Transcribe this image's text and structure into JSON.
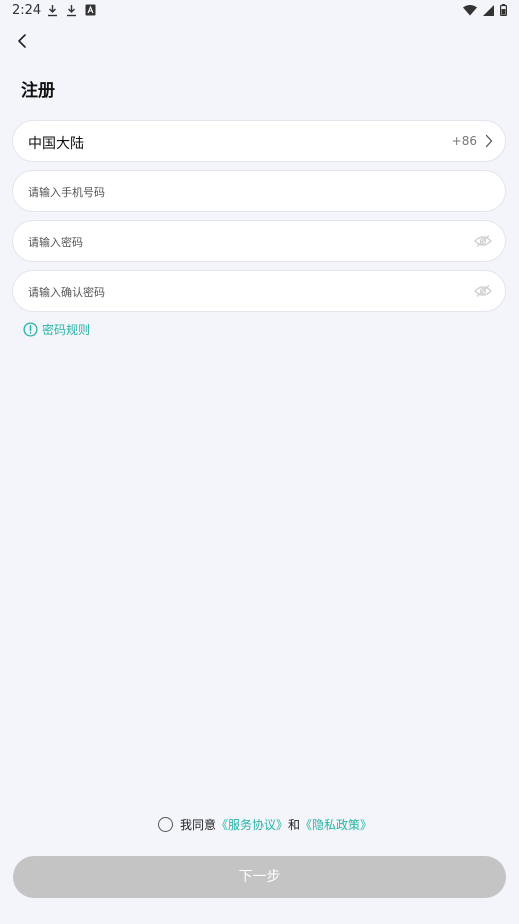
{
  "status_bar": {
    "time": "2:24",
    "icons": [
      "download-icon",
      "download-icon",
      "notification-a-icon",
      "wifi-icon",
      "signal-icon",
      "battery-icon"
    ]
  },
  "page": {
    "title": "注册"
  },
  "region_field": {
    "label": "中国大陆",
    "code": "+86"
  },
  "phone_field": {
    "placeholder": "请输入手机号码"
  },
  "password_field": {
    "placeholder": "请输入密码"
  },
  "confirm_password_field": {
    "placeholder": "请输入确认密码"
  },
  "password_rules": {
    "label": "密码规则"
  },
  "agreement": {
    "prefix": "我同意",
    "service_link": "《服务协议》",
    "conjunction": "和",
    "privacy_link": "《隐私政策》"
  },
  "next_button": {
    "label": "下一步"
  },
  "colors": {
    "background": "#f4f5fa",
    "accent": "#26b3a6",
    "button_disabled": "#c4c4c4"
  }
}
